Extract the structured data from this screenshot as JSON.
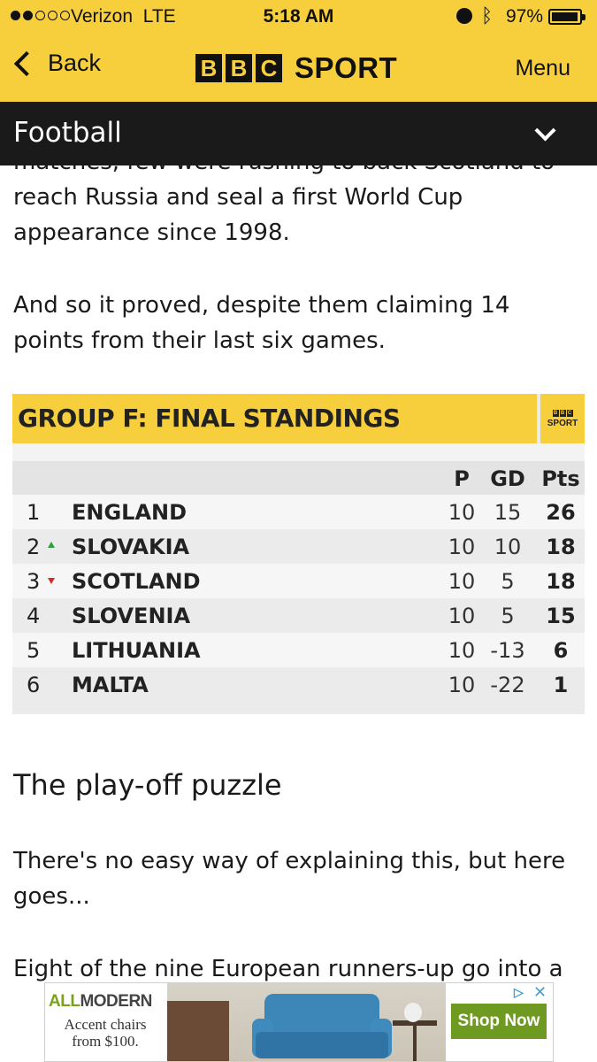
{
  "status_bar": {
    "carrier": "Verizon",
    "network": "LTE",
    "time": "5:18 AM",
    "battery": "97%",
    "battery_level": 0.97
  },
  "nav": {
    "back_label": "Back",
    "logo_letters": [
      "B",
      "B",
      "C"
    ],
    "logo_word": "SPORT",
    "menu_label": "Menu"
  },
  "section": {
    "title": "Football"
  },
  "article": {
    "cut_line": "matches, few were rushing to back Scotland to",
    "para1": "reach Russia and seal a first World Cup appearance since 1998.",
    "para2": "And so it proved, despite them claiming 14 points from their last six games.",
    "heading": "The play-off puzzle",
    "para3": "There's no easy way of explaining this, but here goes...",
    "para4": "Eight of the nine European runners-up go into a"
  },
  "standings": {
    "title": "GROUP F: FINAL STANDINGS",
    "badge_letters": [
      "B",
      "B",
      "C"
    ],
    "badge_word": "SPORT",
    "columns": {
      "p": "P",
      "gd": "GD",
      "pts": "Pts"
    },
    "rows": [
      {
        "pos": "1",
        "move": "",
        "team": "ENGLAND",
        "p": "10",
        "gd": "15",
        "pts": "26"
      },
      {
        "pos": "2",
        "move": "up",
        "team": "SLOVAKIA",
        "p": "10",
        "gd": "10",
        "pts": "18"
      },
      {
        "pos": "3",
        "move": "down",
        "team": "SCOTLAND",
        "p": "10",
        "gd": "5",
        "pts": "18"
      },
      {
        "pos": "4",
        "move": "",
        "team": "SLOVENIA",
        "p": "10",
        "gd": "5",
        "pts": "15"
      },
      {
        "pos": "5",
        "move": "",
        "team": "LITHUANIA",
        "p": "10",
        "gd": "-13",
        "pts": "6"
      },
      {
        "pos": "6",
        "move": "",
        "team": "MALTA",
        "p": "10",
        "gd": "-22",
        "pts": "1"
      }
    ],
    "colors": {
      "accent": "#f7ce3c",
      "up": "#2e9e3f",
      "down": "#d62a2a"
    }
  },
  "ad": {
    "brand_all": "ALL",
    "brand_modern": "MODERN",
    "tagline": "Accent chairs from $100.",
    "cta": "Shop Now",
    "adchoices_icon": "adchoices-icon",
    "close_icon": "close-icon"
  }
}
